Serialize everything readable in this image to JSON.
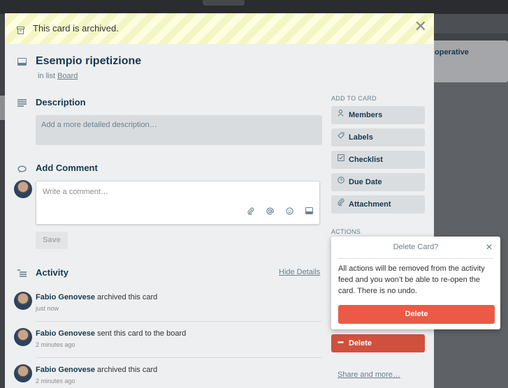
{
  "background": {
    "list_title": "operative"
  },
  "banner": {
    "text": "This card is archived.",
    "close_glyph": "✕"
  },
  "card": {
    "title": "Esempio ripetizione",
    "in_list_prefix": "in list",
    "list_name": "Board"
  },
  "description": {
    "title": "Description",
    "placeholder": "Add a more detailed description…"
  },
  "comment": {
    "title": "Add Comment",
    "placeholder": "Write a comment…",
    "save_label": "Save"
  },
  "activity": {
    "title": "Activity",
    "hide_details": "Hide Details",
    "items": [
      {
        "user": "Fabio Genovese",
        "action": "archived this card",
        "time": "just now"
      },
      {
        "user": "Fabio Genovese",
        "action": "sent this card to the board",
        "time": "2 minutes ago"
      },
      {
        "user": "Fabio Genovese",
        "action": "archived this card",
        "time": "2 minutes ago"
      }
    ]
  },
  "sidebar": {
    "add_to_card": "ADD TO CARD",
    "buttons": [
      {
        "label": "Members",
        "icon": "person-icon"
      },
      {
        "label": "Labels",
        "icon": "tag-icon"
      },
      {
        "label": "Checklist",
        "icon": "checkbox-icon"
      },
      {
        "label": "Due Date",
        "icon": "clock-icon"
      },
      {
        "label": "Attachment",
        "icon": "paperclip-icon"
      }
    ],
    "actions": "ACTIONS",
    "delete_label": "Delete",
    "share_label": "Share and more…"
  },
  "popover": {
    "title": "Delete Card?",
    "close_glyph": "✕",
    "body": "All actions will be removed from the activity feed and you won’t be able to re-open the card. There is no undo.",
    "delete_label": "Delete"
  },
  "colors": {
    "danger": "#eb5a46",
    "danger_dark": "#cf513d",
    "modal_bg": "#edeff0",
    "text": "#17394d",
    "muted": "#6b808c"
  }
}
